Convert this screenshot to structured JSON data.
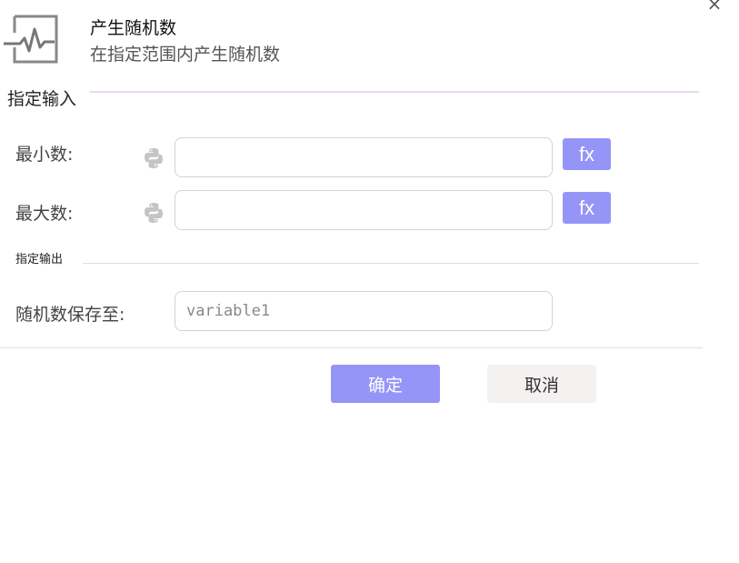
{
  "dialog": {
    "close_symbol": "×",
    "title": "产生随机数",
    "subtitle": "在指定范围内产生随机数",
    "header_icon": "pulse-icon"
  },
  "input_section": {
    "title": "指定输入",
    "fields": [
      {
        "label": "最小数:",
        "value": "",
        "icon": "python-icon",
        "fx_label": "fx"
      },
      {
        "label": "最大数:",
        "value": "",
        "icon": "python-icon",
        "fx_label": "fx"
      }
    ]
  },
  "output_section": {
    "title": "指定输出",
    "save_label": "随机数保存至:",
    "save_placeholder": "variable1"
  },
  "footer": {
    "confirm_label": "确定",
    "cancel_label": "取消"
  },
  "colors": {
    "accent": "#9595f8",
    "secondary_button": "#f4f1f1",
    "section_divider": "#ead8ee"
  }
}
